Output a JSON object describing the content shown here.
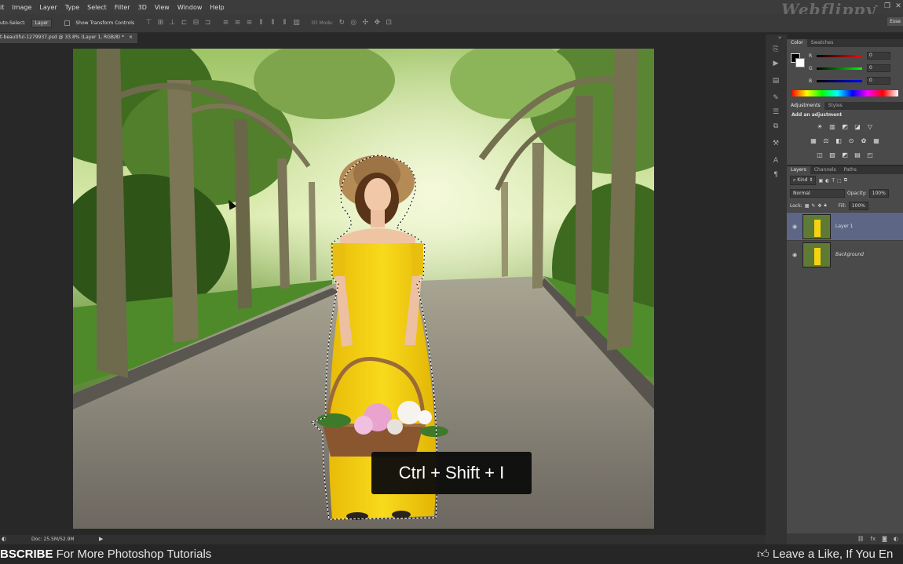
{
  "menubar": {
    "items": [
      "it",
      "Image",
      "Layer",
      "Type",
      "Select",
      "Filter",
      "3D",
      "View",
      "Window",
      "Help"
    ],
    "watermark": "Webflippy"
  },
  "options": {
    "auto_select_label": "uto-Select:",
    "auto_select_value": "Layer",
    "show_transform_label": "Show Transform Controls",
    "mode_3d_label": "3D Mode:",
    "workspace_button": "Esse"
  },
  "document": {
    "tab_title": "t-beautiful-1279937.psd @ 33.8% (Layer 1, RGB/8) *",
    "tab_close": "×"
  },
  "overlay": {
    "shortcut": "Ctrl + Shift + I"
  },
  "statusbar": {
    "doc_size": "Doc: 25.5M/52.9M"
  },
  "color_panel": {
    "tabs": [
      "Color",
      "Swatches"
    ],
    "channels": [
      {
        "label": "R",
        "value": "0"
      },
      {
        "label": "G",
        "value": "0"
      },
      {
        "label": "B",
        "value": "0"
      }
    ]
  },
  "adjustments_panel": {
    "tabs": [
      "Adjustments",
      "Styles"
    ],
    "heading": "Add an adjustment"
  },
  "layers_panel": {
    "tabs": [
      "Layers",
      "Channels",
      "Paths"
    ],
    "kind_label": "Kind",
    "blend_mode": "Normal",
    "opacity_label": "Opacity:",
    "opacity_value": "100%",
    "lock_label": "Lock:",
    "fill_label": "Fill:",
    "fill_value": "100%",
    "layers": [
      {
        "name": "Layer 1",
        "selected": true
      },
      {
        "name": "Background",
        "selected": false
      }
    ]
  },
  "bottom_banner": {
    "left_bold": "BSCRIBE",
    "left_text": " For More Photoshop Tutorials",
    "right_text": "Leave a Like, If You En"
  },
  "colors": {
    "dress": "#f5d312",
    "foliage": "#4f7a2c",
    "selected_layer": "#5d6785"
  }
}
